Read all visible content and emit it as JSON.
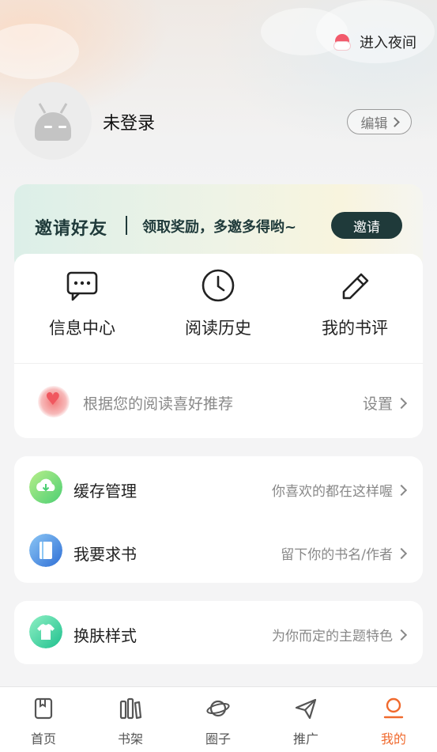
{
  "header": {
    "night_mode_label": "进入夜间",
    "night_icon": "weather-cloud-sun-icon"
  },
  "profile": {
    "username": "未登录",
    "edit_label": "编辑",
    "avatar_icon": "android-robot-icon"
  },
  "invite_banner": {
    "title": "邀请好友",
    "subtitle": "领取奖励，多邀多得哟~",
    "button_label": "邀请"
  },
  "quick_actions": [
    {
      "label": "信息中心",
      "icon": "message-icon"
    },
    {
      "label": "阅读历史",
      "icon": "clock-icon"
    },
    {
      "label": "我的书评",
      "icon": "pencil-icon"
    }
  ],
  "recommendation": {
    "text": "根据您的阅读喜好推荐",
    "settings_label": "设置",
    "icon": "heart-icon"
  },
  "list_items": [
    {
      "label": "缓存管理",
      "hint": "你喜欢的都在这样喔",
      "icon": "cloud-download-icon",
      "color": "#7cd86f"
    },
    {
      "label": "我要求书",
      "hint": "留下你的书名/作者",
      "icon": "book-icon",
      "color": "#4a90e2"
    },
    {
      "label": "换肤样式",
      "hint": "为你而定的主题特色",
      "icon": "tshirt-icon",
      "color": "#3fd6a6"
    }
  ],
  "tabbar": {
    "items": [
      {
        "label": "首页",
        "icon": "home-book-icon"
      },
      {
        "label": "书架",
        "icon": "bookshelf-icon"
      },
      {
        "label": "圈子",
        "icon": "planet-icon"
      },
      {
        "label": "推广",
        "icon": "paper-plane-icon"
      },
      {
        "label": "我的",
        "icon": "user-icon"
      }
    ],
    "active_index": 4,
    "active_color": "#f06a2e"
  }
}
